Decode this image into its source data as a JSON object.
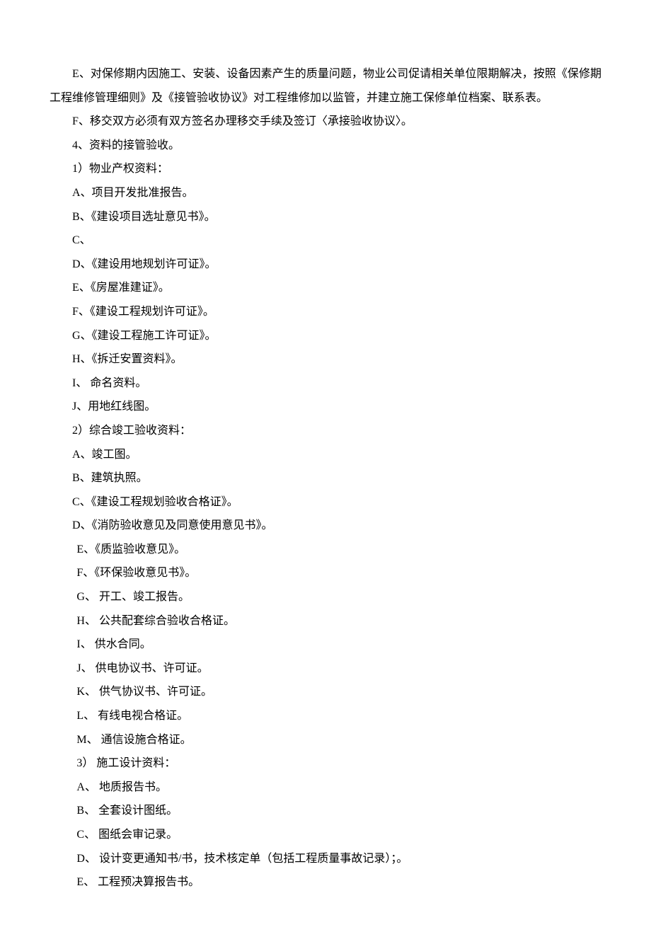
{
  "lines": [
    {
      "cls": "paragraph",
      "text": "E、对保修期内因施工、安装、设备因素产生的质量问题，物业公司促请相关单位限期解决，按照《保修期工程维修管理细则》及《接管验收协议》对工程维修加以监管，并建立施工保修单位档案、联系表。"
    },
    {
      "cls": "list-item",
      "text": "F、移交双方必须有双方签名办理移交手续及签订〈承接验收协议〉。"
    },
    {
      "cls": "list-item",
      "text": "4、资料的接管验收。"
    },
    {
      "cls": "list-item",
      "text": "1）物业产权资料："
    },
    {
      "cls": "list-item",
      "text": "A、项目开发批准报告。"
    },
    {
      "cls": "list-item",
      "text": "B、《建设项目选址意见书》。"
    },
    {
      "cls": "list-item",
      "text": "C、"
    },
    {
      "cls": "list-item",
      "text": "D、《建设用地规划许可证》。"
    },
    {
      "cls": "list-item",
      "text": "E、《房屋准建证》。"
    },
    {
      "cls": "list-item",
      "text": "F、《建设工程规划许可证》。"
    },
    {
      "cls": "list-item",
      "text": "G、《建设工程施工许可证》。"
    },
    {
      "cls": "list-item",
      "text": "H、《拆迁安置资料》。"
    },
    {
      "cls": "list-item",
      "text": "I、 命名资料。"
    },
    {
      "cls": "list-item",
      "text": "J、用地红线图。"
    },
    {
      "cls": "list-item",
      "text": "2）综合竣工验收资料："
    },
    {
      "cls": "list-item",
      "text": "A、竣工图。"
    },
    {
      "cls": "list-item",
      "text": "B、建筑执照。"
    },
    {
      "cls": "list-item",
      "text": "C、《建设工程规划验收合格证》。"
    },
    {
      "cls": "list-item",
      "text": "D、《消防验收意见及同意使用意见书》。"
    },
    {
      "cls": "list-item-wide",
      "text": "E、《质监验收意见》。"
    },
    {
      "cls": "list-item-wide",
      "text": "F、《环保验收意见书》。"
    },
    {
      "cls": "list-item-wide",
      "text": "G、  开工、竣工报告。"
    },
    {
      "cls": "list-item-wide",
      "text": "H、  公共配套综合验收合格证。"
    },
    {
      "cls": "list-item-wide",
      "text": "I、  供水合同。"
    },
    {
      "cls": "list-item-wide",
      "text": "J、  供电协议书、许可证。"
    },
    {
      "cls": "list-item-wide",
      "text": "K、  供气协议书、许可证。"
    },
    {
      "cls": "list-item-wide",
      "text": "L、  有线电视合格证。"
    },
    {
      "cls": "list-item-wide",
      "text": "M、  通信设施合格证。"
    },
    {
      "cls": "list-item-wide",
      "text": "3）  施工设计资料："
    },
    {
      "cls": "list-item-wide",
      "text": "A、  地质报告书。"
    },
    {
      "cls": "list-item-wide",
      "text": "B、  全套设计图纸。"
    },
    {
      "cls": "list-item-wide",
      "text": "C、  图纸会审记录。"
    },
    {
      "cls": "list-item-wide",
      "text": "D、  设计变更通知书/书，技术核定单（包括工程质量事故记录）；。"
    },
    {
      "cls": "list-item-wide",
      "text": "E、  工程预决算报告书。"
    }
  ]
}
